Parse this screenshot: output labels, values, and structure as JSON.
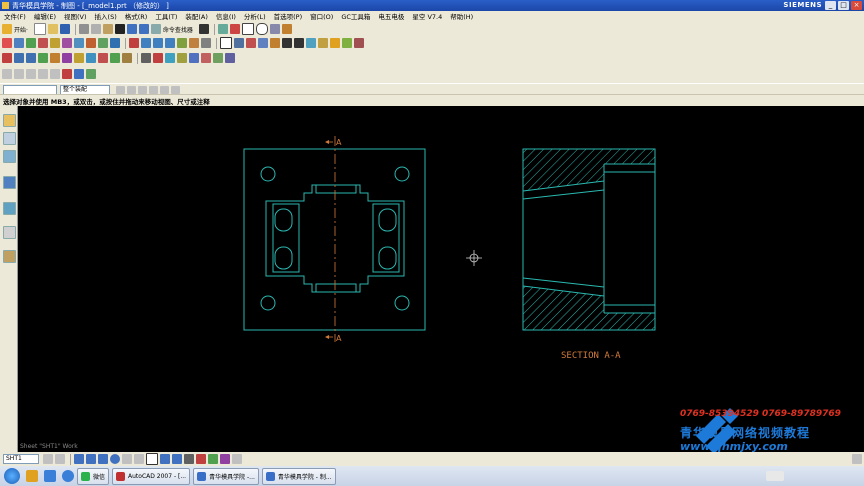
{
  "window": {
    "title": "青华模具学院 - 制图 - [_model1.prt （修改的） ]",
    "brand": "SIEMENS",
    "controls": [
      "_",
      "□",
      "×"
    ]
  },
  "menus": [
    "文件(F)",
    "编辑(E)",
    "视图(V)",
    "插入(S)",
    "格式(R)",
    "工具(T)",
    "装配(A)",
    "信息(I)",
    "分析(L)",
    "首选项(P)",
    "窗口(O)",
    "GC工具箱",
    "电五电极",
    "星空 V7.4",
    "帮助(H)"
  ],
  "toolbar": {
    "start_label": "开始·",
    "command_finder": "命令查找器"
  },
  "selection_bar": {
    "filter": "",
    "scope": "整个装配"
  },
  "cue_line": "选择对象并使用 MB3，或双击，或按住并拖动来移动视图、尺寸或注释",
  "drawing": {
    "section_label_top": "A",
    "section_label_bottom": "A",
    "section_title": "SECTION  A-A",
    "colors": {
      "geometry": "#2ab8b0",
      "centerline": "#d27a3a",
      "hatch": "#2ab8b0",
      "annotation": "#d27a3a"
    }
  },
  "sheet_label": "Sheet \"SHT1\" Work",
  "statusbar": {
    "sheet_combo": "SHT1"
  },
  "taskbar": {
    "items": [
      {
        "label": "微信",
        "color": "#2bb24c"
      },
      {
        "label": "AutoCAD 2007 - [...",
        "color": "#c03030"
      },
      {
        "label": "青华模具学院 -...",
        "color": "#3a6fc8"
      },
      {
        "label": "青华模具学院 - 制...",
        "color": "#3a6fc8"
      }
    ]
  },
  "watermark": {
    "phone": "0769-85394529  0769-89789769",
    "name": "青华模具网络视频教程",
    "url": "www.qhmjxy.com"
  }
}
